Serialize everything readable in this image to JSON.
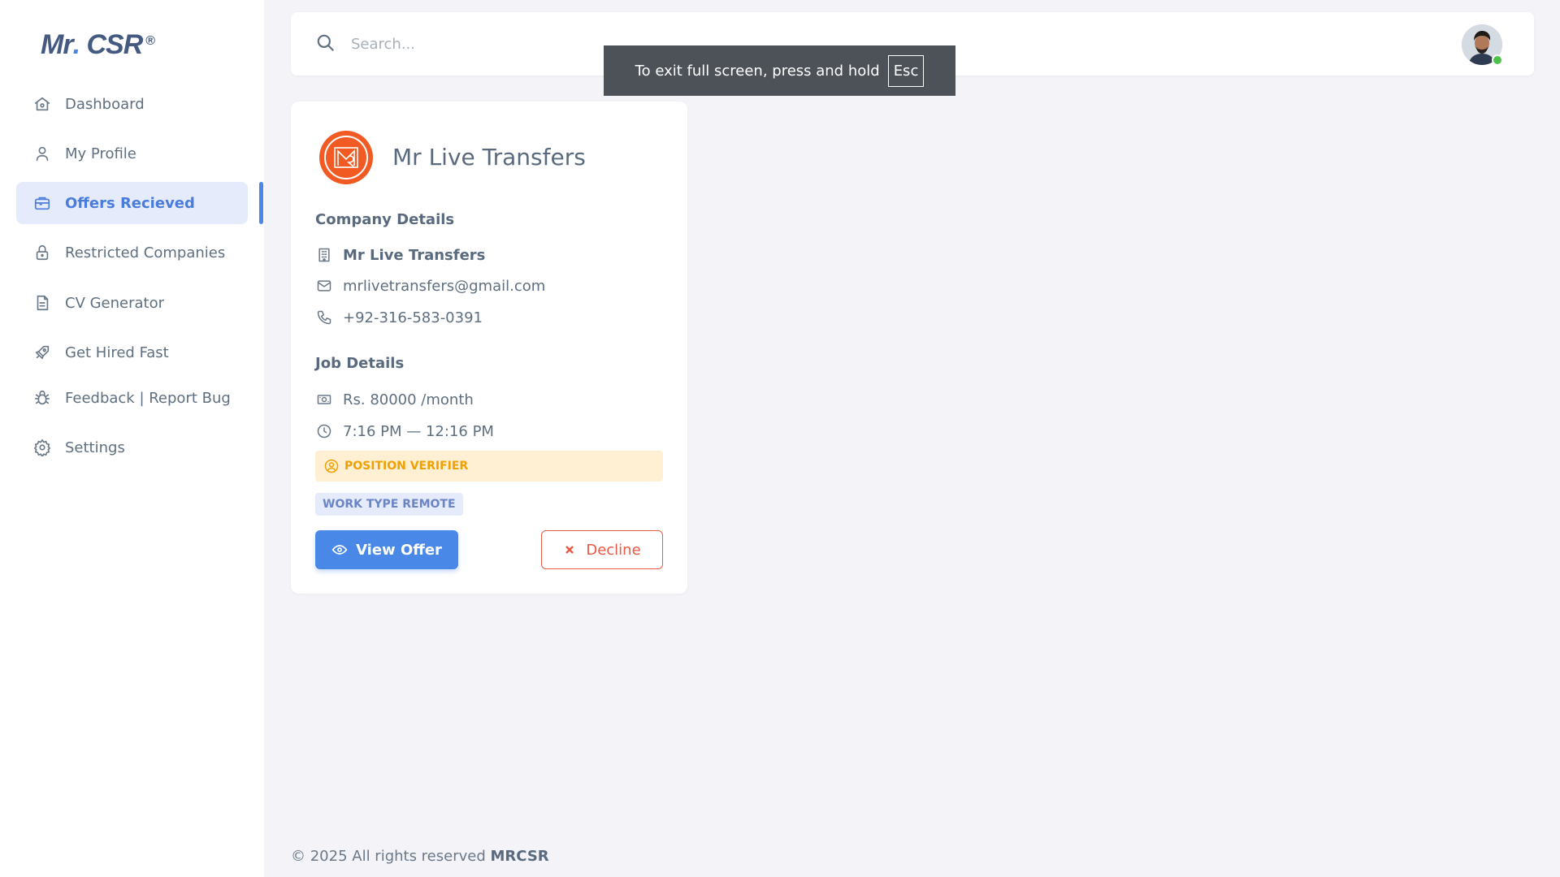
{
  "brand": {
    "name": "Mr",
    "dot": ".",
    "suffix": " CSR",
    "reg": "®"
  },
  "sidebar": {
    "items": [
      {
        "label": "Dashboard",
        "icon": "home-icon"
      },
      {
        "label": "My Profile",
        "icon": "user-icon"
      },
      {
        "label": "Offers Recieved",
        "icon": "briefcase-icon",
        "active": true
      },
      {
        "label": "Restricted Companies",
        "icon": "lock-icon"
      },
      {
        "label": "CV Generator",
        "icon": "document-icon"
      },
      {
        "label": "Get Hired Fast",
        "icon": "rocket-icon"
      },
      {
        "label": "Feedback | Report Bug",
        "icon": "bug-icon"
      },
      {
        "label": "Settings",
        "icon": "gear-icon"
      }
    ]
  },
  "header": {
    "search_placeholder": "Search...",
    "status": "online"
  },
  "toast": {
    "text": "To exit full screen, press and hold",
    "key": "Esc"
  },
  "offer": {
    "company_name": "Mr Live Transfers",
    "company_details_title": "Company Details",
    "company": "Mr Live Transfers",
    "email": "mrlivetransfers@gmail.com",
    "phone": "+92-316-583-0391",
    "job_details_title": "Job Details",
    "salary": "Rs. 80000 /month",
    "time": "7:16 PM — 12:16 PM",
    "position": "POSITION VERIFIER",
    "work_type": "WORK TYPE REMOTE",
    "view_label": "View Offer",
    "decline_label": "Decline"
  },
  "footer": {
    "text": "© 2025 All rights reserved ",
    "brand": "MRCSR"
  },
  "colors": {
    "accent": "#4a88e8",
    "danger": "#ea5a45",
    "warning": "#f0a000",
    "company_logo": "#f15a22",
    "online": "#4cc24c"
  }
}
